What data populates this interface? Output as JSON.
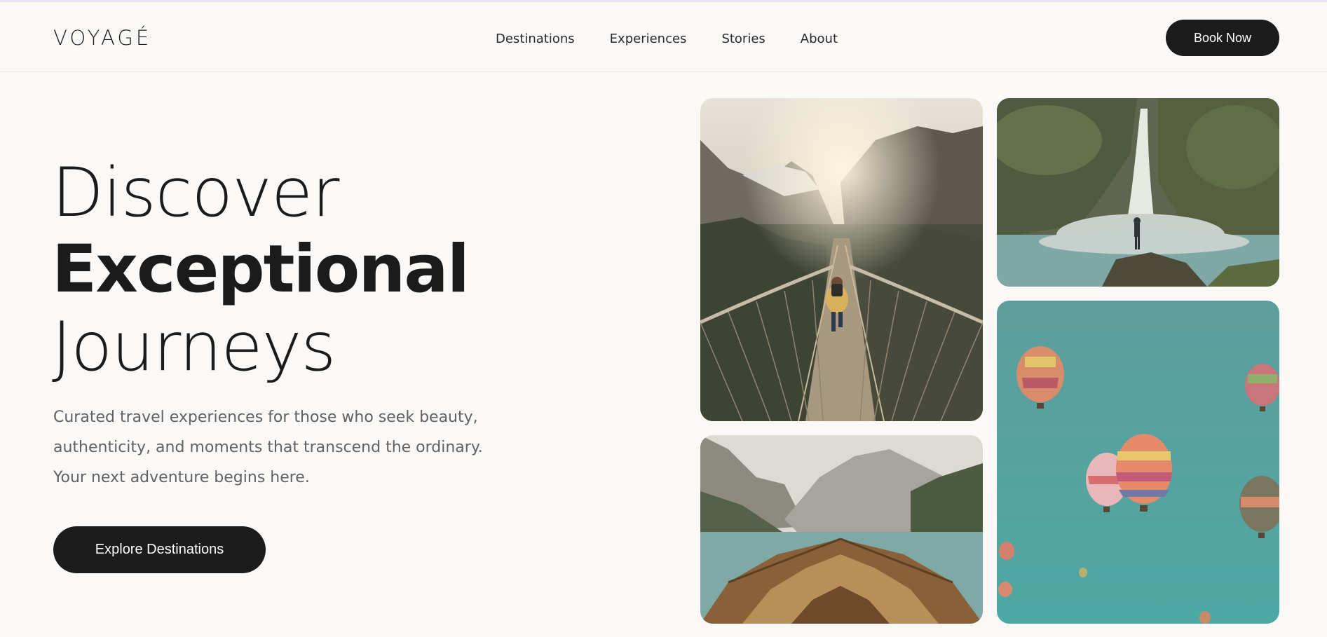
{
  "brand": {
    "logo": "VOYAGÉ"
  },
  "nav": {
    "items": [
      "Destinations",
      "Experiences",
      "Stories",
      "About"
    ],
    "cta": "Book Now"
  },
  "hero": {
    "title_line1": "Discover",
    "title_line2": "Exceptional",
    "title_line3": "Journeys",
    "description": "Curated travel experiences for those who seek beauty, authenticity, and moments that transcend the ordinary. Your next adventure begins here.",
    "cta": "Explore Destinations"
  },
  "colors": {
    "background": "#faf9f7",
    "button": "#1c1c1c",
    "text": "#1b1b1b",
    "muted_text": "#626262"
  },
  "gallery": {
    "images": [
      "suspension-bridge-mountains",
      "waterfall-hiker",
      "boat-mountain-lake",
      "hot-air-balloons"
    ]
  }
}
